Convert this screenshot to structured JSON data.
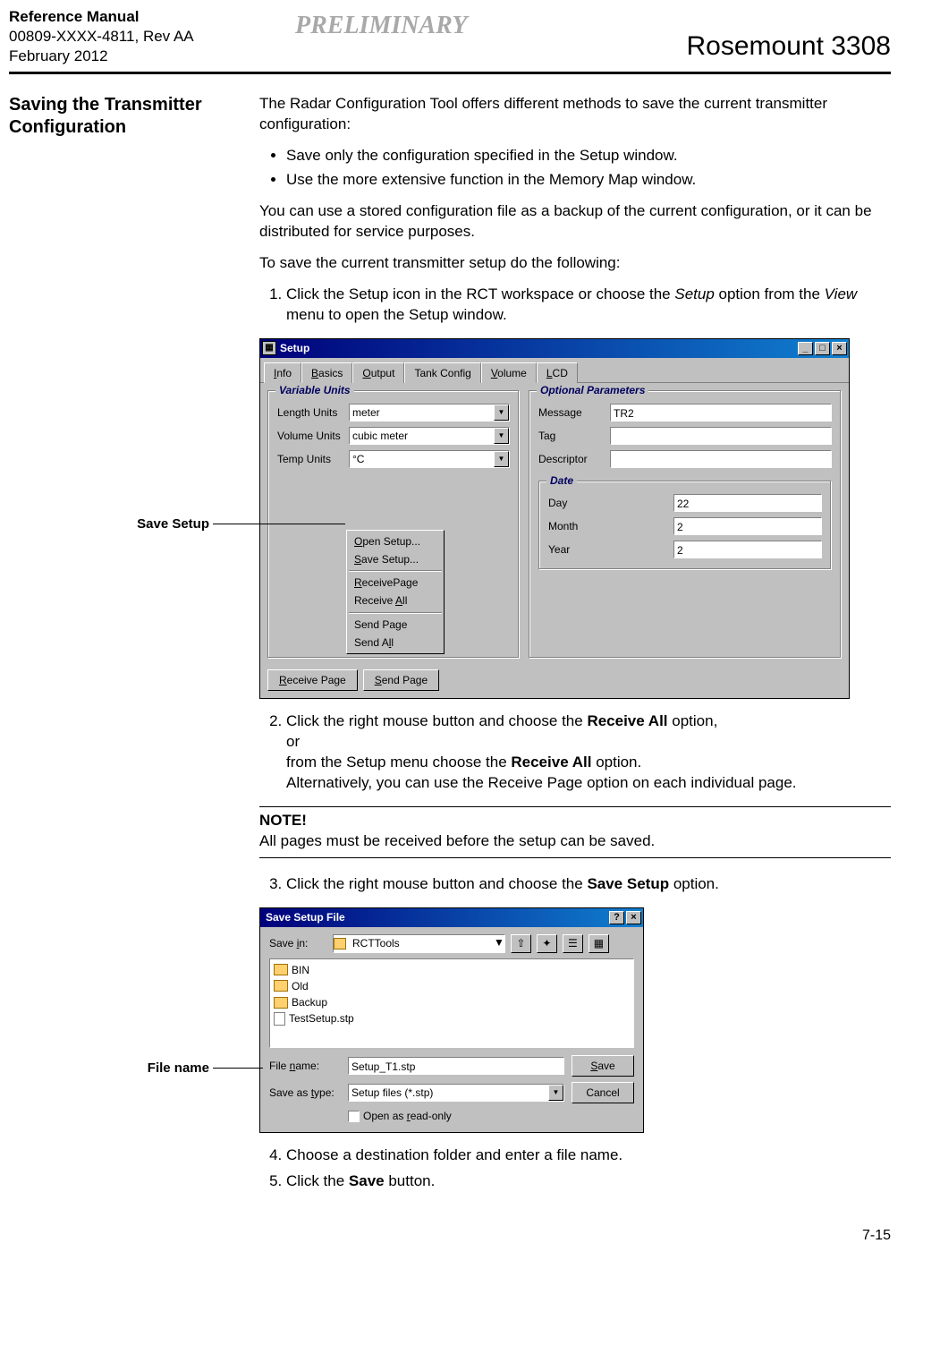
{
  "header": {
    "manual": "Reference Manual",
    "docnum": "00809-XXXX-4811, Rev AA",
    "date": "February 2012",
    "preliminary": "PRELIMINARY",
    "product": "Rosemount 3308"
  },
  "section": {
    "title": "Saving the Transmitter Configuration"
  },
  "body": {
    "intro": "The Radar Configuration Tool offers different methods to save the current transmitter configuration:",
    "bul1": "Save only the configuration specified in the Setup window.",
    "bul2": "Use the more extensive function in the Memory Map window.",
    "para2": "You can use a stored configuration file as a backup of the current configuration, or it can be distributed for service purposes.",
    "para3": "To save the current transmitter setup do the following:",
    "step1a": "Click the Setup icon in the RCT workspace or choose the ",
    "step1b": "Setup",
    "step1c": " option from the ",
    "step1d": "View",
    "step1e": " menu to open the Setup window.",
    "step2a": "Click the right mouse button and choose the ",
    "step2b": "Receive All",
    "step2c": " option,",
    "step2d": "or",
    "step2e": "from the Setup menu choose the ",
    "step2f": "Receive All",
    "step2g": " option.",
    "step2h": "Alternatively, you can use the Receive Page option on each individual page.",
    "noteLbl": "NOTE!",
    "noteTxt": "All pages must be received before the setup can be saved.",
    "step3a": "Click the right mouse button and choose the ",
    "step3b": "Save Setup",
    "step3c": " option.",
    "step4": "Choose a destination folder and enter a file name.",
    "step5a": "Click the ",
    "step5b": "Save",
    "step5c": " button."
  },
  "callouts": {
    "save_setup": "Save Setup",
    "file_name": "File name"
  },
  "setup_win": {
    "title": "Setup",
    "tabs": {
      "info": "Info",
      "basics": "Basics",
      "output": "Output",
      "tank": "Tank Config",
      "volume": "Volume",
      "lcd": "LCD"
    },
    "grp1_title": "Variable Units",
    "len_lbl": "Length Units",
    "len_val": "meter",
    "vol_lbl": "Volume Units",
    "vol_val": "cubic meter",
    "tmp_lbl": "Temp Units",
    "tmp_val": "°C",
    "grp2_title": "Optional Parameters",
    "msg_lbl": "Message",
    "msg_val": "TR2",
    "tag_lbl": "Tag",
    "tag_val": "",
    "desc_lbl": "Descriptor",
    "desc_val": "",
    "date_title": "Date",
    "day_lbl": "Day",
    "day_val": "22",
    "mon_lbl": "Month",
    "mon_val": "2",
    "yr_lbl": "Year",
    "yr_val": "2",
    "popup": {
      "open": "Open Setup...",
      "save": "Save Setup...",
      "recvp": "ReceivePage",
      "recva": "Receive All",
      "sendp": "Send Page",
      "senda": "Send All"
    },
    "btn_recv": "Receive Page",
    "btn_send": "Send Page"
  },
  "save_dlg": {
    "title": "Save Setup File",
    "savein_lbl": "Save in:",
    "savein_val": "RCTTools",
    "files": [
      "BIN",
      "Old",
      "Backup",
      "TestSetup.stp"
    ],
    "fname_lbl": "File name:",
    "fname_val": "Setup_T1.stp",
    "ftype_lbl": "Save as type:",
    "ftype_val": "Setup files (*.stp)",
    "readonly_lbl": "Open as read-only",
    "save_btn": "Save",
    "cancel_btn": "Cancel"
  },
  "page_num": "7-15"
}
